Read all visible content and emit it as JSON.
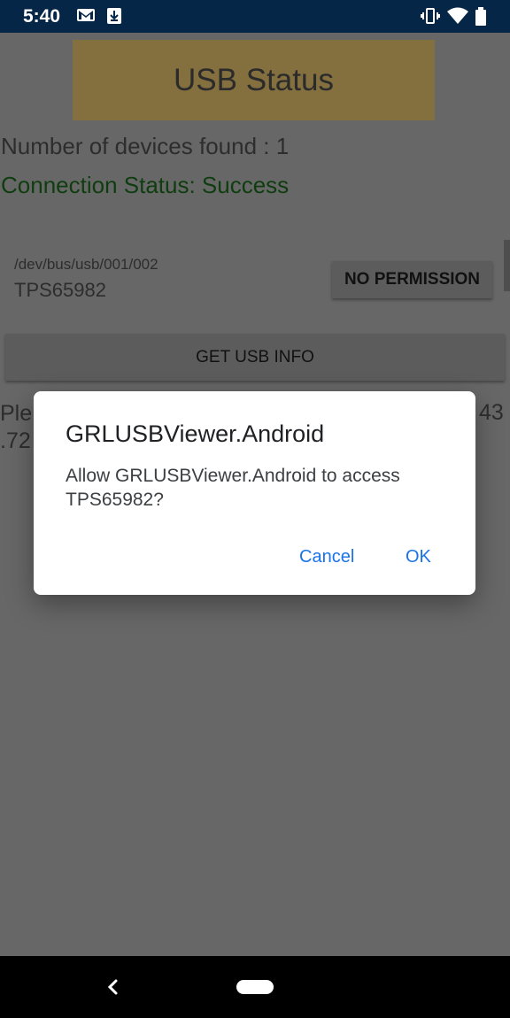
{
  "status_bar": {
    "time": "5:40",
    "icons": [
      "gmail-icon",
      "download-icon",
      "vibrate-icon",
      "wifi-icon",
      "battery-icon"
    ]
  },
  "app": {
    "title": "USB Status",
    "device_count_text": "Number of devices found : 1",
    "connection_status_text": "Connection Status: Success",
    "device": {
      "path": "/dev/bus/usb/001/002",
      "name": "TPS65982",
      "permission_button": "NO PERMISSION"
    },
    "get_info_button": "GET USB INFO",
    "message_left_line1": "Ple",
    "message_left_line2": ".72",
    "message_right": "43"
  },
  "dialog": {
    "title": "GRLUSBViewer.Android",
    "message": "Allow GRLUSBViewer.Android to access TPS65982?",
    "cancel_label": "Cancel",
    "ok_label": "OK"
  },
  "colors": {
    "status_bar": "#062647",
    "accent": "#1a73e8",
    "title_box": "#846f3e",
    "success_text": "#0f3d10"
  }
}
